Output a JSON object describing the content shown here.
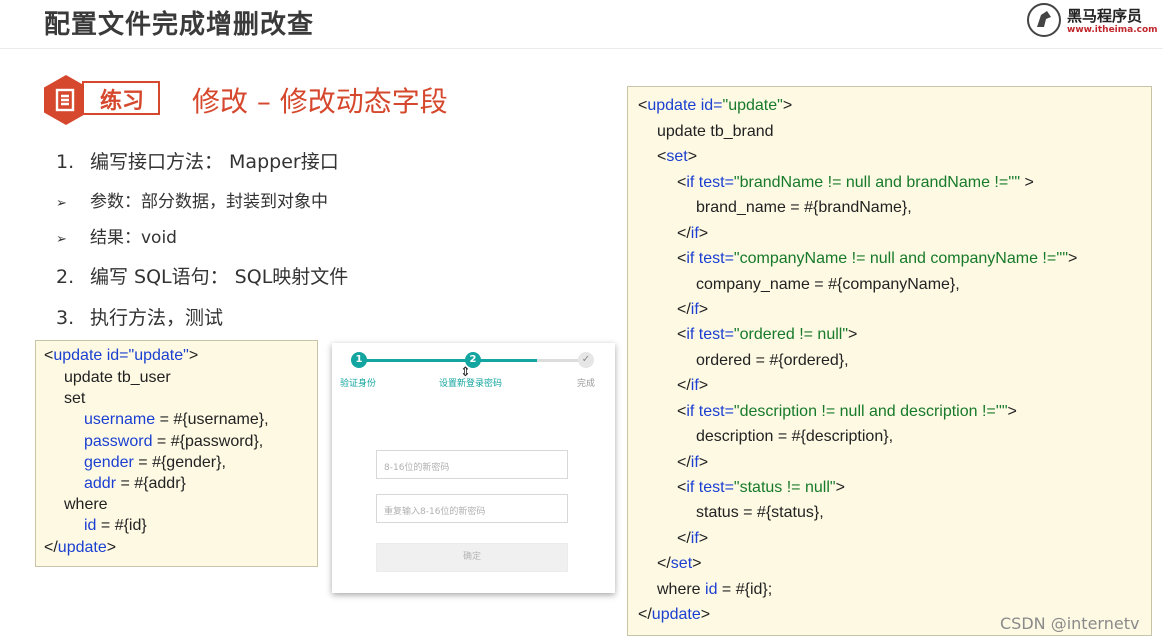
{
  "header": {
    "title": "配置文件完成增删改查",
    "logo_name": "黑马程序员",
    "logo_url": "www.itheima.com"
  },
  "badge": {
    "label": "练习"
  },
  "section_title": "修改 – 修改动态字段",
  "steps": [
    {
      "num": "1.",
      "text": "编写接口方法： Mapper接口"
    },
    {
      "num": "2.",
      "text": "编写 SQL语句： SQL映射文件"
    },
    {
      "num": "3.",
      "text": "执行方法，测试"
    }
  ],
  "bullets": [
    {
      "arrow": "➢",
      "text": "参数：部分数据，封装到对象中"
    },
    {
      "arrow": "➢",
      "text": "结果：void"
    }
  ],
  "left_code": {
    "line1_a": "<",
    "line1_b": "update",
    "line1_c": " id=",
    "line1_d": "\"update\"",
    "line1_e": ">",
    "line2": "update tb_user",
    "line3": "set",
    "line4_a": "username",
    "line4_b": " = #{username},",
    "line5_a": "password",
    "line5_b": " = #{password},",
    "line6_a": "gender",
    "line6_b": " = #{gender},",
    "line7_a": "addr",
    "line7_b": " = #{addr}",
    "line8": "where",
    "line9_a": "id",
    "line9_b": " = #{id}",
    "line10_a": "</",
    "line10_b": "update",
    "line10_c": ">"
  },
  "form": {
    "step1_num": "1",
    "step2_num": "2",
    "step3_num": "✓",
    "step1_label": "验证身份",
    "step2_label": "设置新登录密码",
    "step3_label": "完成",
    "progress_fraction": 0.78,
    "field1_placeholder": "8-16位的新密码",
    "field2_placeholder": "重复输入8-16位的新密码",
    "confirm_label": "确定",
    "cursor": "⇕"
  },
  "right_code": {
    "l1_a": "<",
    "l1_b": "update",
    "l1_c": " id=",
    "l1_d": "\"update\"",
    "l1_e": ">",
    "l2": "update tb_brand",
    "l3_a": "<",
    "l3_b": "set",
    "l3_c": ">",
    "l4_a": "<",
    "l4_b": "if",
    "l4_c": " test=",
    "l4_d": "\"brandName != null and brandName !=''\"",
    "l4_e": " >",
    "l5": "brand_name = #{brandName},",
    "l6_a": "</",
    "l6_b": "if",
    "l6_c": ">",
    "l7_a": "<",
    "l7_b": "if",
    "l7_c": " test=",
    "l7_d": "\"companyName != null and companyName !=''\"",
    "l7_e": ">",
    "l8": "company_name = #{companyName},",
    "l9_a": "</",
    "l9_b": "if",
    "l9_c": ">",
    "l10_a": "<",
    "l10_b": "if",
    "l10_c": " test=",
    "l10_d": "\"ordered != null\"",
    "l10_e": ">",
    "l11": "ordered = #{ordered},",
    "l12_a": "</",
    "l12_b": "if",
    "l12_c": ">",
    "l13_a": "<",
    "l13_b": "if",
    "l13_c": " test=",
    "l13_d": "\"description != null and description !=''\"",
    "l13_e": ">",
    "l14": "description = #{description},",
    "l15_a": "</",
    "l15_b": "if",
    "l15_c": ">",
    "l16_a": "<",
    "l16_b": "if",
    "l16_c": " test=",
    "l16_d": "\"status != null\"",
    "l16_e": ">",
    "l17": "status = #{status},",
    "l18_a": "</",
    "l18_b": "if",
    "l18_c": ">",
    "l19_a": "</",
    "l19_b": "set",
    "l19_c": ">",
    "l20_a": "where ",
    "l20_b": "id",
    "l20_c": " = #{id};",
    "l21_a": "</",
    "l21_b": "update",
    "l21_c": ">"
  },
  "watermark": "CSDN @internetv",
  "colors": {
    "accent": "#d6482d",
    "teal": "#13a5a0",
    "code_bg": "#fdf9e3",
    "code_blue": "#1a3fd1",
    "code_green": "#177a2a"
  }
}
